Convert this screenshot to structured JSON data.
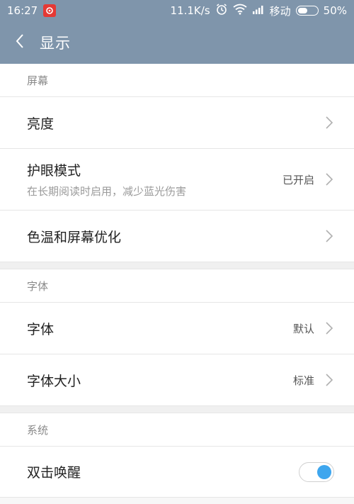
{
  "status_bar": {
    "time": "16:27",
    "network_speed": "11.1K/s",
    "carrier": "移动",
    "battery": "50%",
    "battery_level": 0.5
  },
  "header": {
    "back_icon": "chevron-left-icon",
    "title": "显示"
  },
  "sections": {
    "screen": {
      "header": "屏幕",
      "brightness": {
        "label": "亮度"
      },
      "eye_protection": {
        "label": "护眼模式",
        "sub": "在长期阅读时启用，减少蓝光伤害",
        "value": "已开启"
      },
      "color_temp": {
        "label": "色温和屏幕优化"
      }
    },
    "font": {
      "header": "字体",
      "font": {
        "label": "字体",
        "value": "默认"
      },
      "font_size": {
        "label": "字体大小",
        "value": "标准"
      }
    },
    "system": {
      "header": "系统",
      "double_tap": {
        "label": "双击唤醒",
        "toggle_on": true
      }
    }
  },
  "colors": {
    "header_bg": "#7f95ab",
    "toggle_on": "#3ea6ee"
  }
}
